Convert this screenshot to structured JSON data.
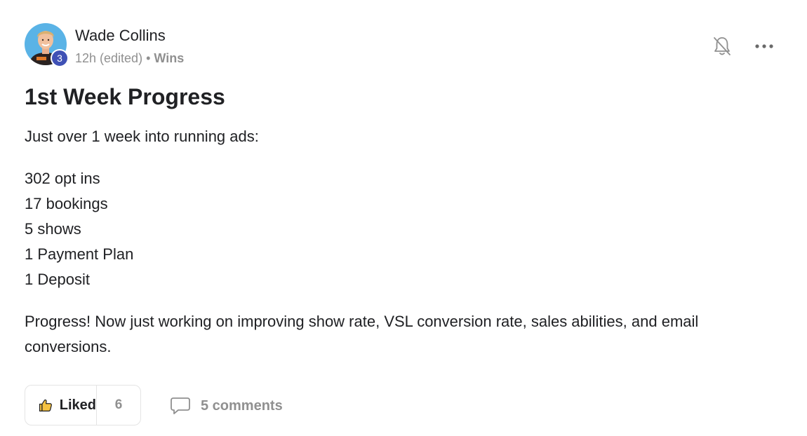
{
  "post": {
    "author": {
      "name": "Wade Collins",
      "level": "3",
      "avatar_icon": "user-avatar-photo"
    },
    "meta": {
      "time": "12h (edited)",
      "separator": "•",
      "category": "Wins"
    },
    "title": "1st Week Progress",
    "body": {
      "intro": "Just over 1 week into running ads:",
      "stats": [
        "302 opt ins",
        "17 bookings",
        "5 shows",
        "1 Payment Plan",
        "1 Deposit"
      ],
      "outro": "Progress! Now just working on improving show rate, VSL conversion rate, sales abilities, and email conversions."
    },
    "actions": {
      "like_label": "Liked",
      "like_count": "6",
      "comments_label": "5 comments"
    }
  },
  "icons": {
    "notification": "bell-off-icon",
    "more": "more-horizontal-icon",
    "like": "thumbs-up-icon",
    "comment": "comment-bubble-icon"
  },
  "colors": {
    "text": "#202124",
    "muted": "#909090",
    "badge": "#3f51b5",
    "like_thumb": "#f5c242",
    "border": "#e4e4e4"
  }
}
